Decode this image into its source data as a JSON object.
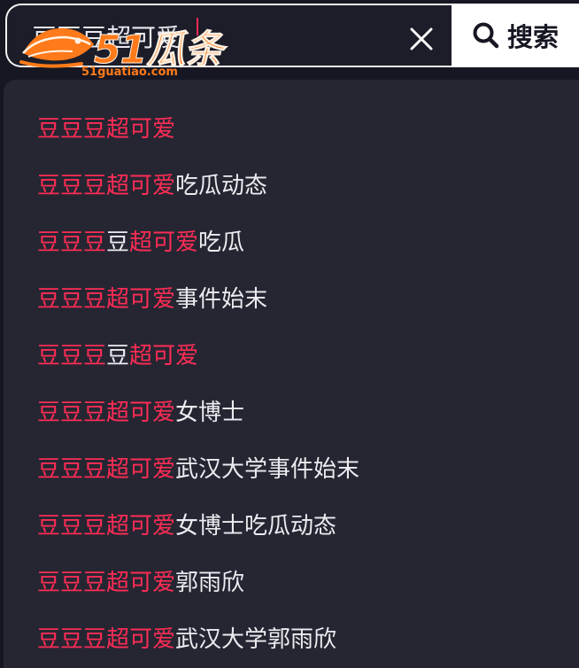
{
  "search": {
    "value": "豆豆豆超可爱",
    "placeholder": "",
    "button_label": "搜索"
  },
  "logo": {
    "text": "51瓜条",
    "subtext": "51guatiao.com"
  },
  "suggestions": [
    {
      "parts": [
        {
          "text": "豆豆豆超可爱",
          "hl": true
        }
      ]
    },
    {
      "parts": [
        {
          "text": "豆豆豆超可爱",
          "hl": true
        },
        {
          "text": "吃瓜动态",
          "hl": false
        }
      ]
    },
    {
      "parts": [
        {
          "text": "豆豆豆",
          "hl": true
        },
        {
          "text": "豆",
          "hl": false
        },
        {
          "text": "超可爱",
          "hl": true
        },
        {
          "text": "吃瓜",
          "hl": false
        }
      ]
    },
    {
      "parts": [
        {
          "text": "豆豆豆超可爱",
          "hl": true
        },
        {
          "text": "事件始末",
          "hl": false
        }
      ]
    },
    {
      "parts": [
        {
          "text": "豆豆豆",
          "hl": true
        },
        {
          "text": "豆",
          "hl": false
        },
        {
          "text": "超可爱",
          "hl": true
        }
      ]
    },
    {
      "parts": [
        {
          "text": "豆豆豆超可爱",
          "hl": true
        },
        {
          "text": "女博士",
          "hl": false
        }
      ]
    },
    {
      "parts": [
        {
          "text": "豆豆豆超可爱",
          "hl": true
        },
        {
          "text": "武汉大学事件始末",
          "hl": false
        }
      ]
    },
    {
      "parts": [
        {
          "text": "豆豆豆超可爱",
          "hl": true
        },
        {
          "text": "女博士吃瓜动态",
          "hl": false
        }
      ]
    },
    {
      "parts": [
        {
          "text": "豆豆豆超可爱",
          "hl": true
        },
        {
          "text": "郭雨欣",
          "hl": false
        }
      ]
    },
    {
      "parts": [
        {
          "text": "豆豆豆超可爱",
          "hl": true
        },
        {
          "text": "武汉大学郭雨欣",
          "hl": false
        }
      ]
    }
  ],
  "colors": {
    "highlight": "#fe2c55",
    "text": "#ececf0",
    "dropdown_bg": "#252632",
    "page_bg": "#161722",
    "logo": "#ff7a1a"
  },
  "icons": {
    "clear": "close-icon",
    "search": "search-icon",
    "logo": "fish-logo-icon"
  }
}
